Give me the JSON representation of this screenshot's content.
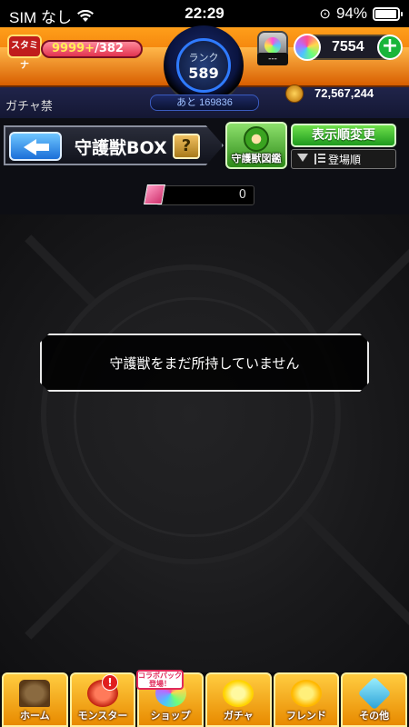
{
  "status_bar": {
    "carrier": "SIM なし",
    "time": "22:29",
    "battery": "94%"
  },
  "hud": {
    "stamina_label": "スタミナ",
    "stamina_current": "9999+",
    "stamina_max": "/382",
    "rank_label": "ランク",
    "rank_value": "589",
    "rank_remaining": "あと 169836",
    "helper_value": "---",
    "orb_count": "7554",
    "gacha_ban": "ガチャ禁",
    "coin_count": "72,567,244"
  },
  "titlebar": {
    "title": "守護獣BOX",
    "help_label": "?",
    "zukan_label": "守護獣図鑑",
    "sort_label": "表示順変更",
    "sort_order": "登場順"
  },
  "count": {
    "value": "0"
  },
  "main": {
    "empty_message": "守護獣をまだ所持していません"
  },
  "bottom_nav": {
    "items": [
      {
        "label": "ホーム",
        "icon": "home-icon"
      },
      {
        "label": "モンスター",
        "icon": "monster-icon"
      },
      {
        "label": "ショップ",
        "icon": "shop-icon"
      },
      {
        "label": "ガチャ",
        "icon": "gacha-icon"
      },
      {
        "label": "フレンド",
        "icon": "friend-icon"
      },
      {
        "label": "その他",
        "icon": "other-icon"
      }
    ],
    "collab_badge": "コラボパック登場！",
    "monster_badge": "!"
  },
  "colors": {
    "accent_orange": "#e86b00",
    "confirm_green": "#19b53a",
    "back_blue": "#1b6fd8"
  }
}
